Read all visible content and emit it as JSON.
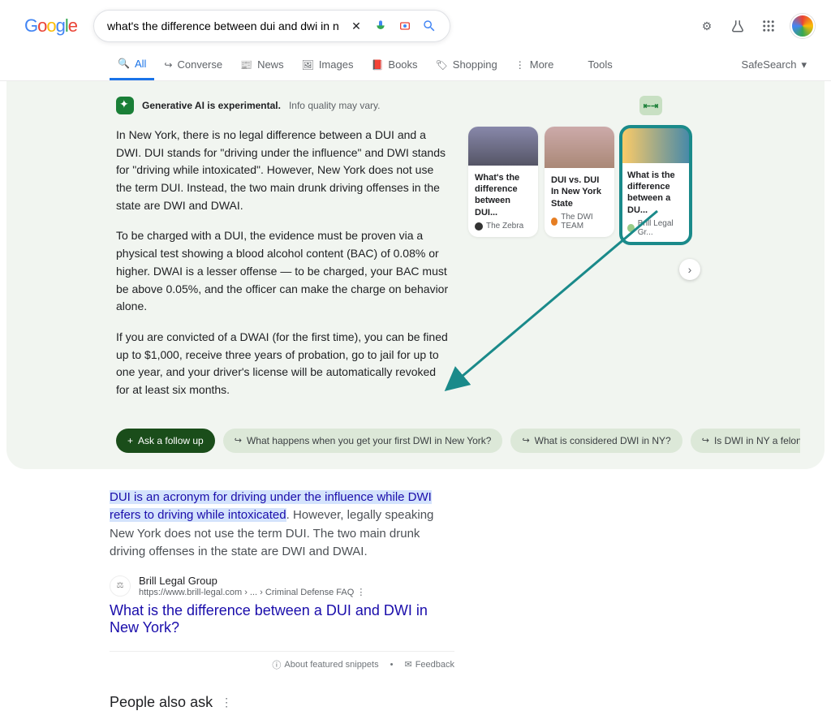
{
  "search": {
    "query": "what's the difference between dui and dwi in new york?"
  },
  "tabs": {
    "all": "All",
    "converse": "Converse",
    "news": "News",
    "images": "Images",
    "books": "Books",
    "shopping": "Shopping",
    "more": "More",
    "tools": "Tools",
    "safesearch": "SafeSearch"
  },
  "sge": {
    "badge_bold": "Generative AI is experimental.",
    "badge_rest": "Info quality may vary.",
    "p1": "In New York, there is no legal difference between a DUI and a DWI. DUI stands for \"driving under the influence\" and DWI stands for \"driving while intoxicated\". However, New York does not use the term DUI. Instead, the two main drunk driving offenses in the state are DWI and DWAI.",
    "p2": "To be charged with a DUI, the evidence must be proven via a physical test showing a blood alcohol content (BAC) of 0.08% or higher. DWAI is a lesser offense — to be charged, your BAC must be above 0.05%, and the officer can make the charge on behavior alone.",
    "p3": "If you are convicted of a DWAI (for the first time), you can be fined up to $1,000, receive three years of probation, go to jail for up to one year, and your driver's license will be automatically revoked for at least six months.",
    "cards": [
      {
        "title": "What's the difference between DUI...",
        "source": "The Zebra"
      },
      {
        "title": "DUI vs. DUI In New York State",
        "source": "The DWI TEAM"
      },
      {
        "title": "What is the difference between a DU...",
        "source": "Brill Legal Gr..."
      }
    ],
    "chips": {
      "ask": "Ask a follow up",
      "c1": "What happens when you get your first DWI in New York?",
      "c2": "What is considered DWI in NY?",
      "c3": "Is DWI in NY a felony"
    }
  },
  "result": {
    "snippet_hl": "DUI is an acronym for driving under the influence while DWI refers to driving while intoxicated",
    "snippet_rest": ". However, legally speaking New York does not use the term DUI. The two main drunk driving offenses in the state are DWI and DWAI.",
    "source_name": "Brill Legal Group",
    "source_url": "https://www.brill-legal.com › ... › Criminal Defense FAQ",
    "title": "What is the difference between a DUI and DWI in New York?",
    "about_snippets": "About featured snippets",
    "feedback": "Feedback"
  },
  "paa": "People also ask"
}
